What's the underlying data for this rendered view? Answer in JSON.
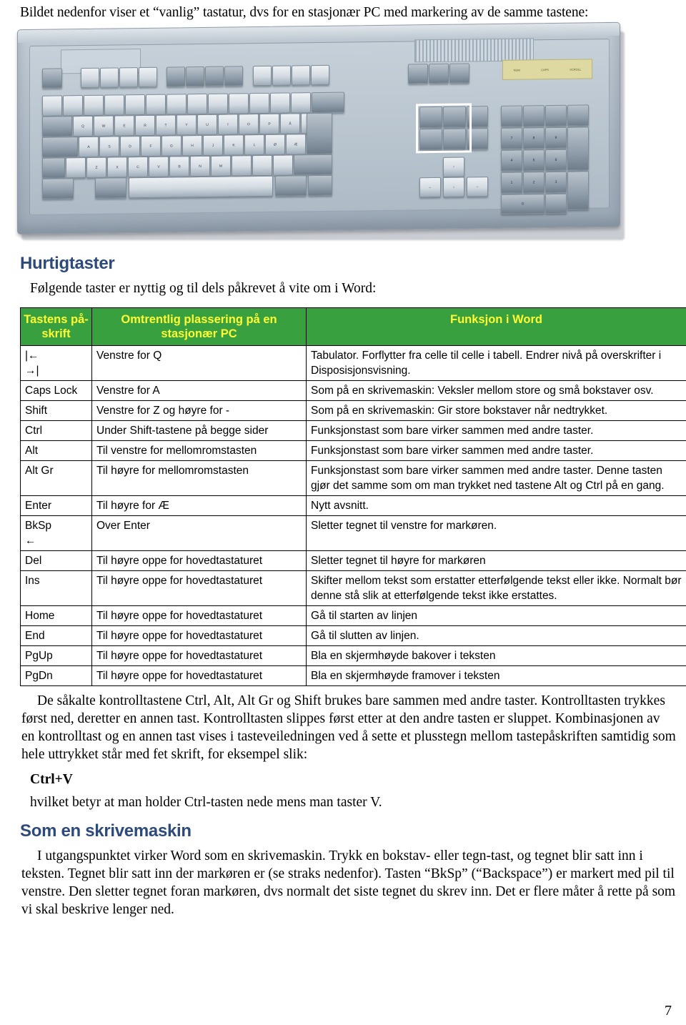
{
  "intro": {
    "text": "Bildet nedenfor viser et “vanlig” tastatur, dvs for en stasjonær PC med markering av de samme tastene:"
  },
  "photo": {
    "alt": "Fotografi av et vanlig stasjonært PC-tastatur med hvit markeringsramme rundt Insert/Home/Delete/End-blokken",
    "leds": [
      "NUM",
      "CAPS",
      "SCROLL"
    ],
    "top_row_keys": [
      "Esc",
      "F1",
      "F2",
      "F3",
      "F4",
      "F5",
      "F6",
      "F7",
      "F8",
      "F9",
      "F10",
      "F11",
      "F12",
      "Print Screen",
      "Scroll Lock",
      "Pause"
    ],
    "nav_keys": [
      "Insert",
      "Home",
      "PgUp",
      "Delete",
      "End",
      "PgDn"
    ],
    "letter_rows": [
      [
        "Q",
        "W",
        "E",
        "R",
        "T",
        "Y",
        "U",
        "I",
        "O",
        "P",
        "Å"
      ],
      [
        "A",
        "S",
        "D",
        "F",
        "G",
        "H",
        "J",
        "K",
        "L",
        "Ø",
        "Æ"
      ],
      [
        "Z",
        "X",
        "C",
        "V",
        "B",
        "N",
        "M"
      ]
    ],
    "number_row": [
      "1",
      "2",
      "3",
      "4",
      "5",
      "6",
      "7",
      "8",
      "9",
      "0",
      "+"
    ],
    "numpad": [
      "Num Lock",
      "/",
      "*",
      "-",
      "7",
      "8",
      "9",
      "4",
      "5",
      "6",
      "+",
      "1",
      "2",
      "3",
      "0",
      ",",
      "Enter"
    ],
    "modifier_keys": [
      "Tab",
      "Caps Lock",
      "Shift",
      "Ctrl",
      "Alt",
      "Alt Gr"
    ]
  },
  "section_quickkeys": {
    "heading": "Hurtigtaster",
    "lead": "Følgende taster er nyttig og til dels påkrevet å vite om i Word:"
  },
  "table": {
    "headers": [
      "Tastens på-skrift",
      "Omtrentlig plassering på en stasjonær PC",
      "Funksjon i Word"
    ],
    "rows": [
      {
        "key": "|←\n→|",
        "placement": "Venstre for Q",
        "function": "Tabulator. Forflytter fra celle til celle i tabell. Endrer nivå på overskrifter i Disposisjonsvisning."
      },
      {
        "key": "Caps Lock",
        "placement": "Venstre for A",
        "function": "Som på en skrivemaskin: Veksler mellom store og små bokstaver osv."
      },
      {
        "key": "Shift",
        "placement": "Venstre for Z og høyre for -",
        "function": "Som på en skrivemaskin: Gir store bokstaver når nedtrykket."
      },
      {
        "key": "Ctrl",
        "placement": "Under Shift-tastene på begge sider",
        "function": "Funksjonstast som bare virker sammen med andre taster."
      },
      {
        "key": "Alt",
        "placement": "Til venstre for mellomromstasten",
        "function": "Funksjonstast som bare virker sammen med andre taster."
      },
      {
        "key": "Alt Gr",
        "placement": "Til høyre for mellomromstasten",
        "function": "Funksjonstast som bare virker sammen med andre taster. Denne tasten gjør det samme som om man trykket ned tastene Alt og Ctrl på en gang."
      },
      {
        "key": "Enter",
        "placement": "Til høyre for Æ",
        "function": "Nytt avsnitt."
      },
      {
        "key": "BkSp\n←",
        "placement": "Over Enter",
        "function": "Sletter tegnet til venstre for markøren."
      },
      {
        "key": "Del",
        "placement": "Til høyre oppe for hovedtastaturet",
        "function": "Sletter tegnet til høyre for markøren"
      },
      {
        "key": "Ins",
        "placement": "Til høyre oppe for hovedtastaturet",
        "function": "Skifter mellom tekst som erstatter etterfølgende tekst eller ikke. Normalt bør denne stå slik at etterfølgende tekst ikke erstattes."
      },
      {
        "key": "Home",
        "placement": "Til høyre oppe for hovedtastaturet",
        "function": "Gå til starten av linjen"
      },
      {
        "key": "End",
        "placement": "Til høyre oppe for hovedtastaturet",
        "function": "Gå til slutten av linjen."
      },
      {
        "key": "PgUp",
        "placement": "Til høyre oppe for hovedtastaturet",
        "function": "Bla en skjermhøyde bakover i teksten"
      },
      {
        "key": "PgDn",
        "placement": "Til høyre oppe for hovedtastaturet",
        "function": "Bla en skjermhøyde framover i teksten"
      }
    ]
  },
  "after_table": {
    "paragraph": "De såkalte kontrolltastene Ctrl, Alt, Alt Gr og Shift brukes bare sammen med andre taster. Kontrolltasten trykkes først ned, deretter en annen tast. Kontrolltasten slippes først etter at den andre tasten er sluppet. Kombinasjonen av en kontrolltast og en annen tast vises i tasteveiledningen ved å sette et plusstegn mellom tastepåskriften samtidig som hele uttrykket står med fet skrift, for eksempel slik:",
    "example": "Ctrl+V",
    "explanation": "hvilket betyr at man holder Ctrl-tasten nede mens man taster V."
  },
  "section_typewriter": {
    "heading": "Som en skrivemaskin",
    "paragraph": "I utgangspunktet virker Word som en skrivemaskin. Trykk en bokstav- eller tegn-tast, og tegnet blir satt inn i teksten. Tegnet blir satt inn der markøren er (se straks nedenfor). Tasten “BkSp” (“Backspace”) er markert med pil til venstre. Den sletter tegnet foran markøren, dvs normalt det siste tegnet du skrev inn. Det er flere måter å rette på som vi skal beskrive lenger ned."
  },
  "footer": {
    "page_number": "7"
  },
  "colors": {
    "heading_blue": "#2d4a7c",
    "table_header_green": "#38a03f",
    "table_header_text_yellow": "#ffff33"
  }
}
